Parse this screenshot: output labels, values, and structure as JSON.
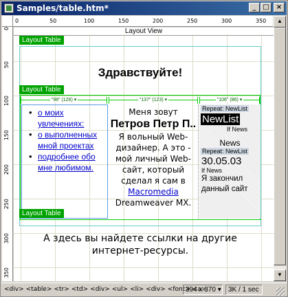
{
  "window": {
    "title": "Samples/table.htm*",
    "min": "_",
    "max": "□",
    "close": "×"
  },
  "ruler": {
    "top": [
      "0",
      "50",
      "100",
      "150",
      "200",
      "250",
      "300",
      "350"
    ],
    "left": [
      "0",
      "50",
      "100",
      "150",
      "200",
      "250",
      "300",
      "350"
    ]
  },
  "canvas": {
    "layout_view": "Layout View",
    "layout_table_label": "Layout Table",
    "heading": "Здравствуйте!",
    "columns": [
      "\"98\" (126) ▾",
      "\"137\" (123) ▾",
      "\"106\" (86) ▾"
    ],
    "links": [
      "о моих увлечениях:",
      "о выполненных мной проектах",
      "подробнее обо мне любимом."
    ],
    "middle": {
      "intro": "Меня зовут",
      "name": "Петров Петр П..",
      "text_a": "Я вольный Web-дизайнер. А это - мой личный Web-сайт, который сделал я сам в",
      "link": "Macromedia",
      "text_b": "Dreamweaver MX."
    },
    "right": {
      "repeat1": "Repeat: NewList",
      "newlist": "NewList",
      "ifnews1": "If News",
      "news": "News",
      "repeat2": "Repeat: NewList",
      "date": "30.05.03",
      "ifnews2": "If News",
      "ended": "Я закончил данный сайт"
    },
    "footer": "А здесь вы найдете ссылки на другие интернет-ресурсы."
  },
  "status": {
    "tags": [
      "<div>",
      "<table>",
      "<tr>",
      "<td>",
      "<div>",
      "<ul>",
      "<li>",
      "<div>",
      "<font>",
      "<a>"
    ],
    "size": "394 x 370 ▾",
    "kb": "3K / 1 sec"
  }
}
